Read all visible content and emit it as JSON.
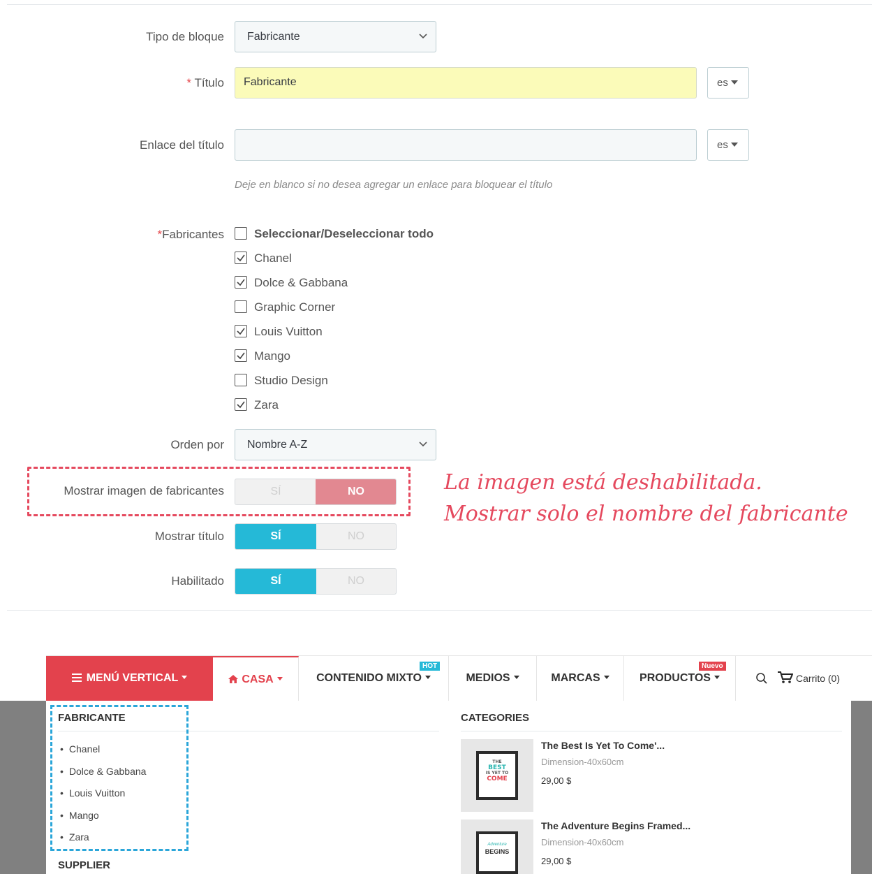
{
  "form": {
    "block_type": {
      "label": "Tipo de bloque",
      "value": "Fabricante"
    },
    "title": {
      "required_mark": "*",
      "label": "Título",
      "value": "Fabricante",
      "lang": "es"
    },
    "title_link": {
      "label": "Enlace del título",
      "value": "",
      "lang": "es",
      "help": "Deje en blanco si no desea agregar un enlace para bloquear el título"
    },
    "manufacturers": {
      "required_mark": "*",
      "label": "Fabricantes",
      "select_all": "Seleccionar/Deseleccionar todo",
      "items": [
        {
          "label": "Chanel",
          "checked": true
        },
        {
          "label": "Dolce & Gabbana",
          "checked": true
        },
        {
          "label": "Graphic Corner",
          "checked": false
        },
        {
          "label": "Louis Vuitton",
          "checked": true
        },
        {
          "label": "Mango",
          "checked": true
        },
        {
          "label": "Studio Design",
          "checked": false
        },
        {
          "label": "Zara",
          "checked": true
        }
      ]
    },
    "order_by": {
      "label": "Orden por",
      "value": "Nombre A-Z"
    },
    "show_image": {
      "label": "Mostrar imagen de fabricantes",
      "yes": "SÍ",
      "no": "NO",
      "selected": "no"
    },
    "show_title": {
      "label": "Mostrar título",
      "yes": "SÍ",
      "no": "NO",
      "selected": "yes"
    },
    "enabled": {
      "label": "Habilitado",
      "yes": "SÍ",
      "no": "NO",
      "selected": "yes"
    }
  },
  "annotation": {
    "line1": "La imagen está deshabilitada.",
    "line2": "Mostrar solo el nombre del fabricante"
  },
  "menu": {
    "vertical": "MENÚ VERTICAL",
    "casa": "CASA",
    "mixed": "CONTENIDO MIXTO",
    "mixed_badge": "HOT",
    "media": "MEDIOS",
    "brands": "MARCAS",
    "products": "PRODUCTOS",
    "products_badge": "Nuevo",
    "cart": "Carrito (0)"
  },
  "dropdown": {
    "manufacturer_title": "FABRICANTE",
    "manufacturers": [
      "Chanel",
      "Dolce & Gabbana",
      "Louis Vuitton",
      "Mango",
      "Zara"
    ],
    "supplier_title": "SUPPLIER",
    "categories_title": "CATEGORIES",
    "products": [
      {
        "name": "The Best Is Yet To Come'...",
        "dimension": "Dimension-40x60cm",
        "price": "29,00 $",
        "poster_lines": [
          "THE",
          "BEST",
          "IS YET TO",
          "COME"
        ]
      },
      {
        "name": "The Adventure Begins Framed...",
        "dimension": "Dimension-40x60cm",
        "price": "29,00 $",
        "poster_lines": [
          "Adventure",
          "BEGINS"
        ]
      }
    ]
  },
  "colors": {
    "accent_red": "#e3424d",
    "accent_blue": "#25b9d7",
    "annotation": "#e5495e"
  }
}
